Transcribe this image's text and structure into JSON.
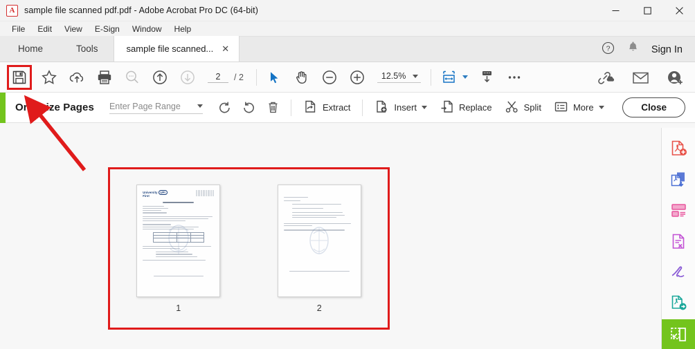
{
  "window": {
    "title": "sample file scanned pdf.pdf - Adobe Acrobat Pro DC (64-bit)",
    "app_icon": "acrobat-icon",
    "minimize": "—",
    "maximize": "□",
    "close": "✕"
  },
  "menubar": {
    "items": [
      {
        "label": "File"
      },
      {
        "label": "Edit"
      },
      {
        "label": "View"
      },
      {
        "label": "E-Sign"
      },
      {
        "label": "Window"
      },
      {
        "label": "Help"
      }
    ]
  },
  "tabbar": {
    "home": "Home",
    "tools": "Tools",
    "document_tab": "sample file scanned...",
    "document_tab_close": "✕",
    "help_icon": "help-circle-icon",
    "bell_icon": "notification-bell-icon",
    "sign_in": "Sign In"
  },
  "toolbar": {
    "save_icon": "save-floppy-icon",
    "star_icon": "star-icon",
    "cloud_upload_icon": "cloud-upload-icon",
    "print_icon": "print-icon",
    "search_icon": "search-icon",
    "previous_page_icon": "arrow-up-circle-icon",
    "next_page_icon": "arrow-down-circle-icon",
    "page_number": "2",
    "page_total": "/ 2",
    "select_tool_icon": "cursor-arrow-icon",
    "hand_tool_icon": "hand-icon",
    "zoom_out_icon": "zoom-out-icon",
    "zoom_in_icon": "zoom-in-icon",
    "zoom_level": "12.5%",
    "fit_page_icon": "fit-page-icon",
    "scroll_mode_icon": "page-scroll-icon",
    "more_icon": "more-horizontal-icon",
    "share_link_icon": "share-link-cloud-icon",
    "email_icon": "email-envelope-icon",
    "add_person_icon": "add-person-icon"
  },
  "organize": {
    "title": "Organize Pages",
    "accent_color": "#73c41d",
    "page_range_placeholder": "Enter Page Range",
    "rotate_ccw_icon": "rotate-counterclockwise-icon",
    "rotate_cw_icon": "rotate-clockwise-icon",
    "delete_icon": "trash-delete-icon",
    "extract_label": "Extract",
    "extract_icon": "extract-pages-icon",
    "insert_label": "Insert",
    "insert_icon": "insert-page-icon",
    "replace_label": "Replace",
    "replace_icon": "replace-page-icon",
    "split_label": "Split",
    "split_icon": "scissors-split-icon",
    "more_label": "More",
    "more_icon": "list-more-icon",
    "close_label": "Close"
  },
  "pages": [
    {
      "label": "1",
      "kind": "letterhead"
    },
    {
      "label": "2",
      "kind": "checklist"
    }
  ],
  "annotation": {
    "highlight_color": "#e01b1b",
    "arrow_color": "#e01b1b",
    "save_highlight": "save-button-highlight",
    "selection_highlight": "pages-selection-highlight"
  },
  "rightbar": {
    "items": [
      {
        "name": "create-pdf-icon",
        "color": "#e8534a"
      },
      {
        "name": "export-pdf-icon",
        "color": "#4a6fd4"
      },
      {
        "name": "prepare-form-icon",
        "color": "#e8559d"
      },
      {
        "name": "edit-pdf-icon",
        "color": "#c252d4"
      },
      {
        "name": "fill-and-sign-icon",
        "color": "#8b5cd6"
      },
      {
        "name": "send-for-signature-icon",
        "color": "#1aa79a"
      },
      {
        "name": "organize-pages-icon",
        "color": "#ffffff",
        "active": true
      }
    ]
  }
}
